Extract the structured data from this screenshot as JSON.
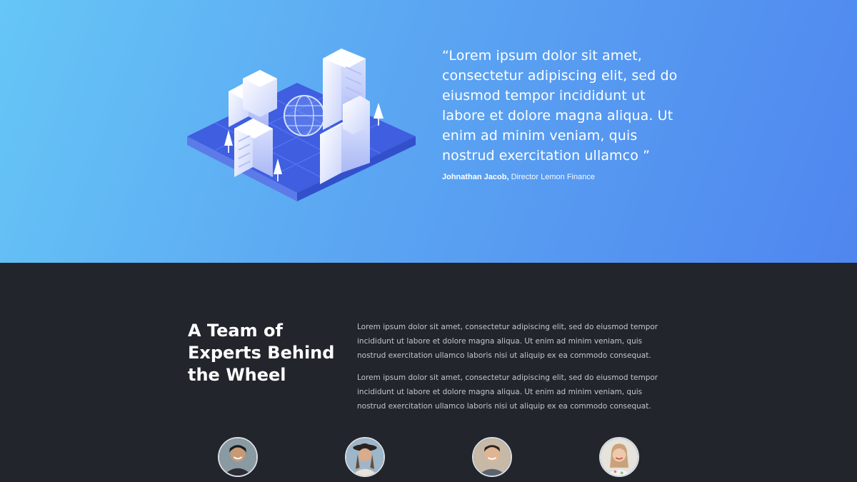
{
  "testimonial": {
    "quote": "“Lorem ipsum dolor sit amet, consectetur adipiscing elit, sed do eiusmod tempor incididunt ut labore et dolore magna aliqua. Ut enim ad minim veniam, quis nostrud exercitation ullamco ”",
    "author_name": "Johnathan Jacob,",
    "author_role": " Director Lemon Finance"
  },
  "team": {
    "heading": "A Team of Experts Behind the Wheel",
    "paragraphs": [
      "Lorem ipsum dolor sit amet, consectetur adipiscing elit, sed do eiusmod tempor incididunt ut labore et dolore magna aliqua. Ut enim ad minim veniam, quis nostrud exercitation ullamco laboris nisi ut aliquip ex ea commodo consequat.",
      "Lorem ipsum dolor sit amet, consectetur adipiscing elit, sed do eiusmod tempor incididunt ut labore et dolore magna aliqua. Ut enim ad minim veniam, quis nostrud exercitation ullamco laboris nisi ut aliquip ex ea commodo consequat."
    ]
  },
  "colors": {
    "hero_gradient_start": "#66c6f6",
    "hero_gradient_end": "#4f86ef",
    "dark_background": "#22252b",
    "body_text": "#c3c6cc"
  },
  "icons": [
    "city-globe-illustration",
    "team-avatar-1",
    "team-avatar-2",
    "team-avatar-3",
    "team-avatar-4"
  ]
}
